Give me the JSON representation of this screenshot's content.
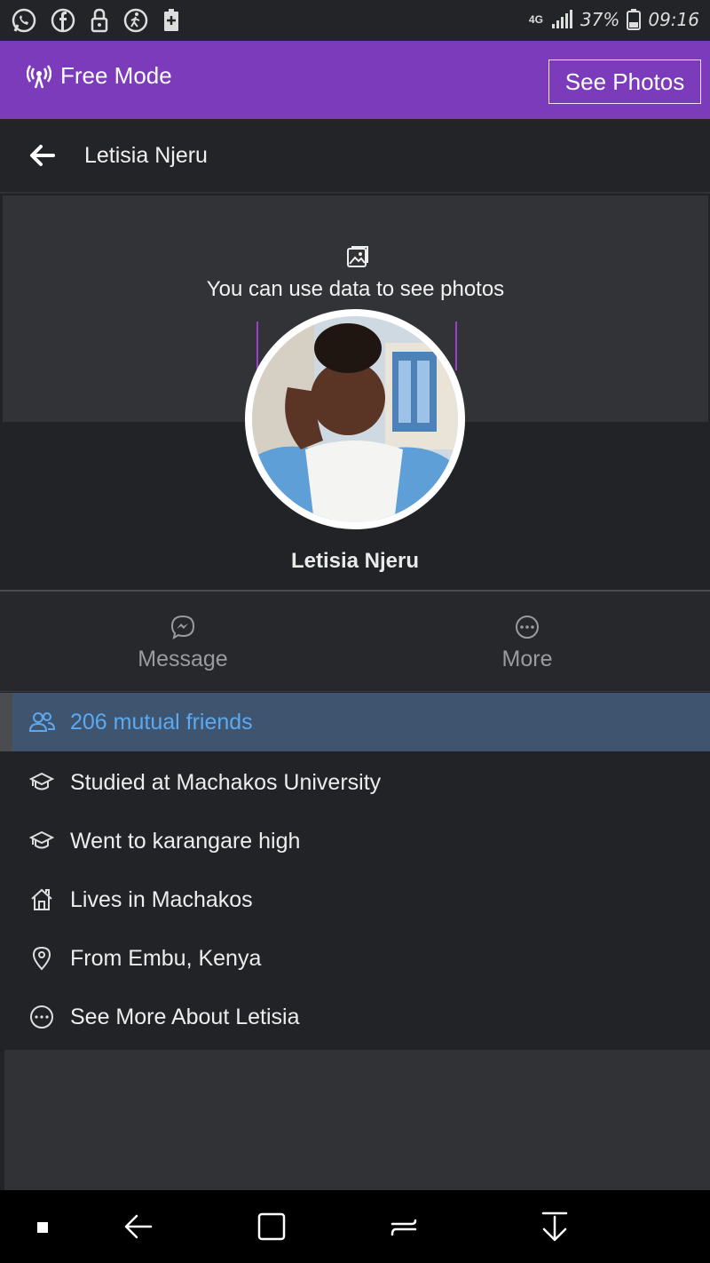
{
  "status_bar": {
    "icons": [
      "whatsapp-icon",
      "facebook-icon",
      "lock-icon",
      "walking-icon",
      "battery-saver-icon"
    ],
    "network": "4G",
    "battery": "37%",
    "time": "09:16"
  },
  "free_mode": {
    "label": "Free Mode",
    "see_photos_label": "See Photos"
  },
  "header": {
    "title": "Letisia Njeru"
  },
  "cover": {
    "message": "You can use data to see photos"
  },
  "profile": {
    "name": "Letisia Njeru"
  },
  "actions": [
    {
      "label": "Message",
      "icon": "messenger-icon"
    },
    {
      "label": "More",
      "icon": "more-icon"
    }
  ],
  "info": {
    "mutual_friends": "206 mutual friends",
    "studied": "Studied at Machakos University",
    "went_to": "Went to karangare high",
    "lives_in": "Lives in Machakos",
    "from": "From Embu, Kenya",
    "see_more": "See More About Letisia"
  },
  "colors": {
    "free_mode_bar": "#7b3bbb",
    "background": "#222326",
    "highlight_row": "#3f556f",
    "link_blue": "#5aa9f2"
  }
}
